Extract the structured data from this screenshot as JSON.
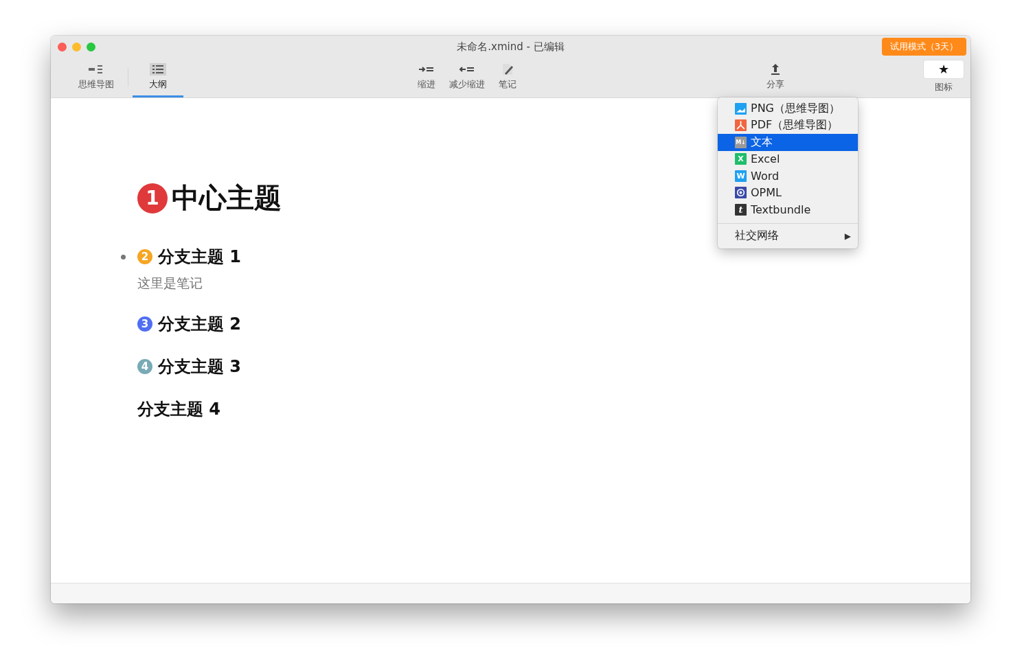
{
  "window": {
    "title": "未命名.xmind - 已编辑",
    "trial_badge": "试用模式（3天）"
  },
  "view_tabs": [
    {
      "label": "思维导图",
      "kind": "mindmap",
      "selected": false
    },
    {
      "label": "大纲",
      "kind": "outline",
      "selected": true
    }
  ],
  "toolbar": [
    {
      "label": "缩进",
      "kind": "indent"
    },
    {
      "label": "减少缩进",
      "kind": "outdent"
    },
    {
      "label": "笔记",
      "kind": "note"
    }
  ],
  "share": {
    "label": "分享",
    "expanded": true
  },
  "icons_button": {
    "label": "图标",
    "glyph": "★"
  },
  "share_menu": {
    "items": [
      {
        "label": "PNG（思维导图）",
        "kind": "png",
        "selected": false
      },
      {
        "label": "PDF（思维导图）",
        "kind": "pdf",
        "selected": false
      },
      {
        "label": "文本",
        "kind": "md",
        "badge": "M↓",
        "selected": true
      },
      {
        "label": "Excel",
        "kind": "excel",
        "badge": "X",
        "selected": false
      },
      {
        "label": "Word",
        "kind": "word",
        "badge": "W",
        "selected": false
      },
      {
        "label": "OPML",
        "kind": "opml",
        "selected": false
      },
      {
        "label": "Textbundle",
        "kind": "textbundle",
        "badge": "t",
        "selected": false
      }
    ],
    "submenu": {
      "label": "社交网络",
      "arrow": "▶"
    }
  },
  "outline": {
    "central": {
      "title": "中心主题",
      "priority": "1",
      "color": "#e0393b"
    },
    "branches": [
      {
        "title": "分支主题 1",
        "priority": "2",
        "color": "#f5a623",
        "bullet": true,
        "note": "这里是笔记"
      },
      {
        "title": "分支主题 2",
        "priority": "3",
        "color": "#4f6ef2",
        "bullet": false
      },
      {
        "title": "分支主题 3",
        "priority": "4",
        "color": "#79aab5",
        "bullet": false
      },
      {
        "title": "分支主题 4",
        "bullet": false
      }
    ]
  }
}
